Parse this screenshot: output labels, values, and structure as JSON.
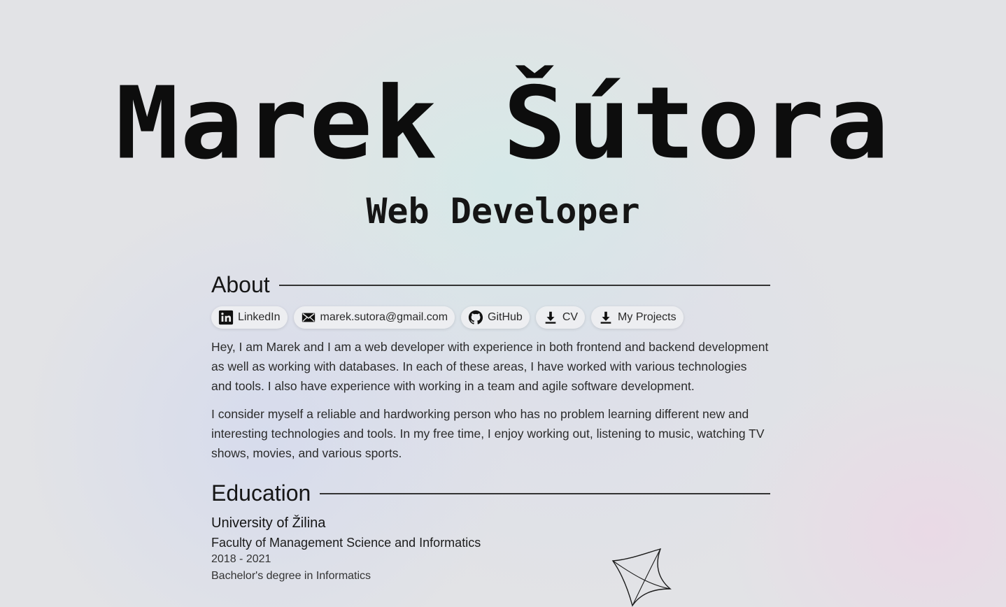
{
  "hero": {
    "name": "Marek Šútora",
    "role": "Web Developer"
  },
  "about": {
    "heading": "About",
    "links": [
      {
        "label": "LinkedIn",
        "icon": "linkedin-icon"
      },
      {
        "label": "marek.sutora@gmail.com",
        "icon": "mail-icon"
      },
      {
        "label": "GitHub",
        "icon": "github-icon"
      },
      {
        "label": "CV",
        "icon": "download-icon"
      },
      {
        "label": "My Projects",
        "icon": "download-icon"
      }
    ],
    "paragraphs": [
      "Hey, I am Marek and I am a web developer with experience in both frontend and backend development as well as working with databases. In each of these areas, I have worked with various technologies and tools. I also have experience with working in a team and agile software development.",
      "I consider myself a reliable and hardworking person who has no problem learning different new and interesting technologies and tools. In my free time, I enjoy working out, listening to music, watching TV shows, movies, and various sports."
    ]
  },
  "education": {
    "heading": "Education",
    "items": [
      {
        "university": "University of Žilina",
        "faculty": "Faculty of Management Science and Informatics",
        "years": "2018 - 2021",
        "degree": "Bachelor's degree in Informatics"
      }
    ]
  },
  "colors": {
    "text": "#1a1a1a",
    "background": "#e2e3e6",
    "rule": "#333333"
  }
}
